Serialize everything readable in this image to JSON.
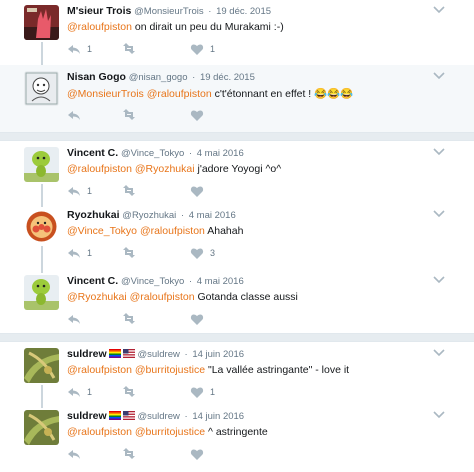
{
  "groups": [
    {
      "tweets": [
        {
          "name": "M'sieur Trois",
          "handle": "@MonsieurTrois",
          "date": "19 déc. 2015",
          "body": [
            {
              "type": "mention",
              "text": "@raloufpiston"
            },
            {
              "type": "text",
              "text": " on dirait un peu du Murakami :-)"
            }
          ],
          "reply_count": "1",
          "retweet_count": "",
          "like_count": "1",
          "avatar_icon": "avatar-red-hand-icon",
          "highlight": false
        },
        {
          "name": "Nisan Gogo",
          "handle": "@nisan_gogo",
          "date": "19 déc. 2015",
          "body": [
            {
              "type": "mention",
              "text": "@MonsieurTrois"
            },
            {
              "type": "text",
              "text": " "
            },
            {
              "type": "mention",
              "text": "@raloufpiston"
            },
            {
              "type": "text",
              "text": " c't'étonnant  en effet ! 😂😂😂"
            }
          ],
          "reply_count": "",
          "retweet_count": "",
          "like_count": "",
          "avatar_icon": "avatar-sketch-icon",
          "highlight": true
        }
      ]
    },
    {
      "tweets": [
        {
          "name": "Vincent C.",
          "handle": "@Vince_Tokyo",
          "date": "4 mai 2016",
          "body": [
            {
              "type": "mention",
              "text": "@raloufpiston"
            },
            {
              "type": "text",
              "text": " "
            },
            {
              "type": "mention",
              "text": "@Ryozhukai"
            },
            {
              "type": "text",
              "text": " j'adore Yoyogi ^o^"
            }
          ],
          "reply_count": "1",
          "retweet_count": "",
          "like_count": "",
          "avatar_icon": "avatar-green-mascot-icon",
          "highlight": false
        },
        {
          "name": "Ryozhukai",
          "handle": "@Ryozhukai",
          "date": "4 mai 2016",
          "body": [
            {
              "type": "mention",
              "text": "@Vince_Tokyo"
            },
            {
              "type": "text",
              "text": " "
            },
            {
              "type": "mention",
              "text": "@raloufpiston"
            },
            {
              "type": "text",
              "text": " Ahahah"
            }
          ],
          "reply_count": "1",
          "retweet_count": "",
          "like_count": "3",
          "avatar_icon": "avatar-anpanman-icon",
          "highlight": false
        },
        {
          "name": "Vincent C.",
          "handle": "@Vince_Tokyo",
          "date": "4 mai 2016",
          "body": [
            {
              "type": "mention",
              "text": "@Ryozhukai"
            },
            {
              "type": "text",
              "text": " "
            },
            {
              "type": "mention",
              "text": "@raloufpiston"
            },
            {
              "type": "text",
              "text": " Gotanda classe aussi"
            }
          ],
          "reply_count": "",
          "retweet_count": "",
          "like_count": "",
          "avatar_icon": "avatar-green-mascot-icon",
          "highlight": false
        }
      ]
    },
    {
      "tweets": [
        {
          "name": "suldrew",
          "flags": [
            "rainbow-flag-icon",
            "us-flag-icon"
          ],
          "handle": "@suldrew",
          "date": "14 juin 2016",
          "body": [
            {
              "type": "mention",
              "text": "@raloufpiston"
            },
            {
              "type": "text",
              "text": " "
            },
            {
              "type": "mention",
              "text": "@burritojustice"
            },
            {
              "type": "text",
              "text": " \"La vallée astringante\" - love it"
            }
          ],
          "reply_count": "1",
          "retweet_count": "",
          "like_count": "1",
          "avatar_icon": "avatar-plant-icon",
          "highlight": false
        },
        {
          "name": "suldrew",
          "flags": [
            "rainbow-flag-icon",
            "us-flag-icon"
          ],
          "handle": "@suldrew",
          "date": "14 juin 2016",
          "body": [
            {
              "type": "mention",
              "text": "@raloufpiston"
            },
            {
              "type": "text",
              "text": " "
            },
            {
              "type": "mention",
              "text": "@burritojustice"
            },
            {
              "type": "text",
              "text": " ^ astringente"
            }
          ],
          "reply_count": "",
          "retweet_count": "",
          "like_count": "",
          "avatar_icon": "avatar-plant-icon",
          "highlight": false
        }
      ]
    }
  ],
  "colors": {
    "mention": "#e8751a",
    "thread_line": "#ccd6dd",
    "background": "#e6ecf0",
    "icon_gray": "#aab8c2"
  }
}
